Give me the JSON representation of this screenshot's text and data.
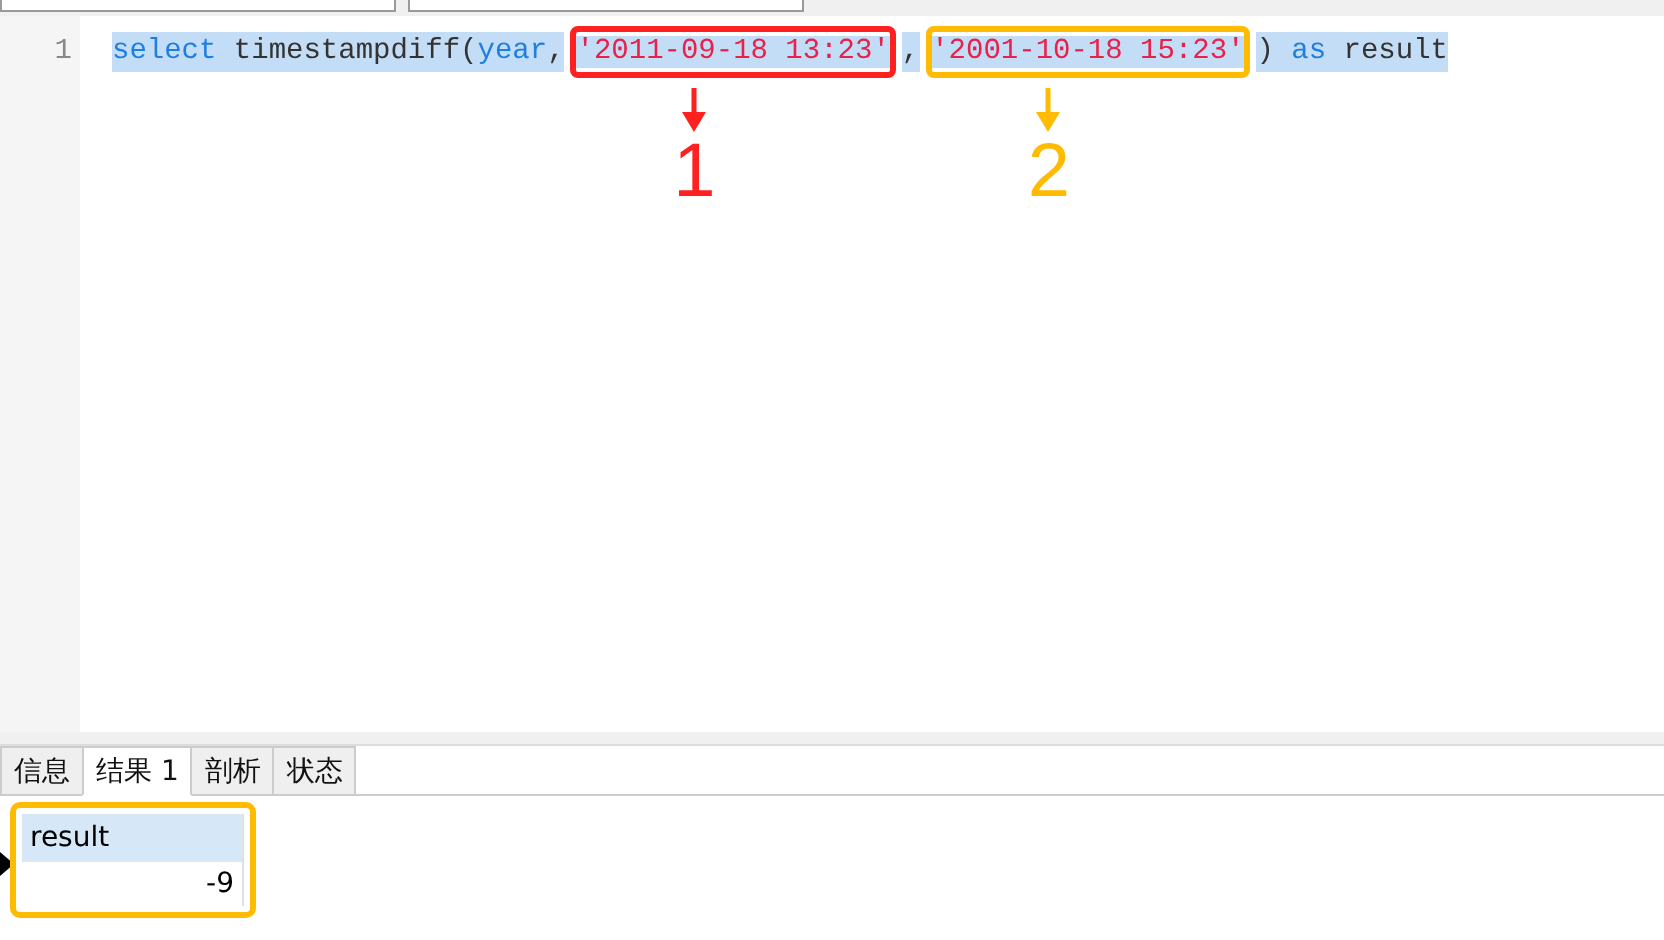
{
  "editor": {
    "lines": [
      {
        "number": "1",
        "tokens": [
          {
            "kind": "keyword",
            "text": "select"
          },
          {
            "kind": "plain",
            "text": " timestampdiff("
          },
          {
            "kind": "keyword",
            "text": "year"
          },
          {
            "kind": "plain",
            "text": ","
          },
          {
            "kind": "string",
            "text": "'2011-09-18 13:23'",
            "callout": {
              "label": "1",
              "color": "#ff2020"
            }
          },
          {
            "kind": "plain",
            "text": ","
          },
          {
            "kind": "string",
            "text": "'2001-10-18 15:23'",
            "callout": {
              "label": "2",
              "color": "#ffbb00"
            }
          },
          {
            "kind": "plain",
            "text": ") "
          },
          {
            "kind": "keyword",
            "text": "as"
          },
          {
            "kind": "plain",
            "text": " result"
          }
        ]
      }
    ]
  },
  "result_tabs": [
    {
      "label": "信息",
      "selected": false
    },
    {
      "label": "结果 1",
      "selected": true
    },
    {
      "label": "剖析",
      "selected": false
    },
    {
      "label": "状态",
      "selected": false
    }
  ],
  "result_grid": {
    "callout": {
      "color": "#ffbb00"
    },
    "columns": [
      "result"
    ],
    "rows": [
      [
        "-9"
      ]
    ]
  }
}
